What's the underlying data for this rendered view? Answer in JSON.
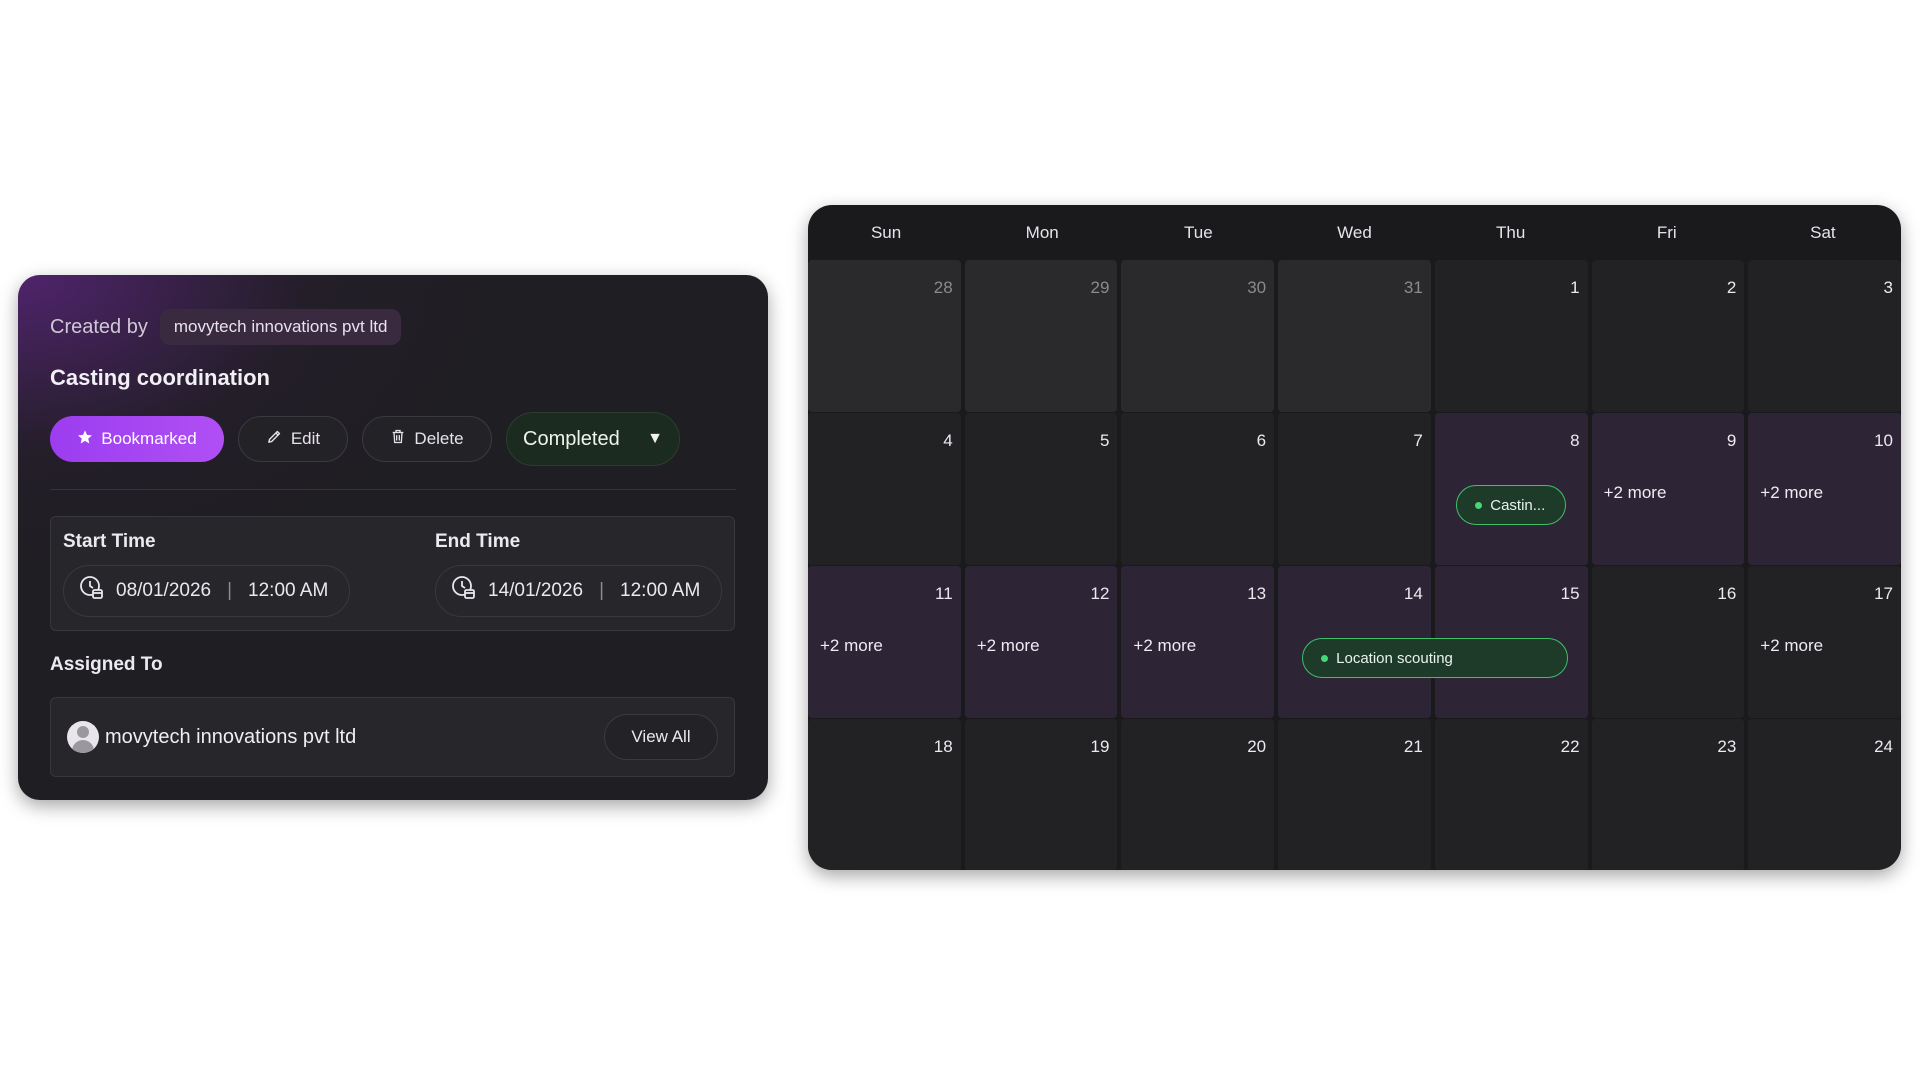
{
  "task": {
    "created_by_label": "Created by",
    "creator": "movytech innovations pvt ltd",
    "title": "Casting coordination",
    "bookmarked_label": "Bookmarked",
    "edit_label": "Edit",
    "delete_label": "Delete",
    "status": "Completed",
    "start_label": "Start Time",
    "start_date": "08/01/2026",
    "start_time": "12:00 AM",
    "end_label": "End Time",
    "end_date": "14/01/2026",
    "end_time": "12:00 AM",
    "assigned_label": "Assigned To",
    "assignee": "movytech innovations pvt ltd",
    "view_all_label": "View All"
  },
  "colors": {
    "accent_purple": "#a144f2",
    "status_green": "#3fbf6a",
    "card_bg": "#1f1e22",
    "calendar_bg": "#1a1a1c"
  },
  "calendar": {
    "weekdays": [
      "Sun",
      "Mon",
      "Tue",
      "Wed",
      "Thu",
      "Fri",
      "Sat"
    ],
    "weeks": [
      [
        {
          "num": "28",
          "outside": true
        },
        {
          "num": "29",
          "outside": true
        },
        {
          "num": "30",
          "outside": true
        },
        {
          "num": "31",
          "outside": true
        },
        {
          "num": "1"
        },
        {
          "num": "2"
        },
        {
          "num": "3"
        }
      ],
      [
        {
          "num": "4"
        },
        {
          "num": "5"
        },
        {
          "num": "6"
        },
        {
          "num": "7"
        },
        {
          "num": "8",
          "event": true
        },
        {
          "num": "9",
          "event": true,
          "more": "+2 more"
        },
        {
          "num": "10",
          "event": true,
          "more": "+2 more"
        }
      ],
      [
        {
          "num": "11",
          "event": true,
          "more": "+2 more"
        },
        {
          "num": "12",
          "event": true,
          "more": "+2 more"
        },
        {
          "num": "13",
          "event": true,
          "more": "+2 more"
        },
        {
          "num": "14",
          "event": true
        },
        {
          "num": "15",
          "event": true
        },
        {
          "num": "16"
        },
        {
          "num": "17",
          "more": "+2 more"
        }
      ],
      [
        {
          "num": "18"
        },
        {
          "num": "19"
        },
        {
          "num": "20"
        },
        {
          "num": "21"
        },
        {
          "num": "22"
        },
        {
          "num": "23"
        },
        {
          "num": "24"
        }
      ]
    ],
    "events": [
      {
        "label": "Castin...",
        "week": 1,
        "col_start": 4,
        "col_span": 1
      },
      {
        "label": "Location scouting",
        "week": 2,
        "col_start": 3,
        "col_span": 2
      }
    ]
  }
}
